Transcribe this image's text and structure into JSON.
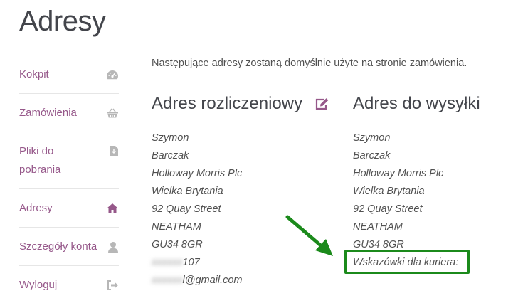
{
  "page": {
    "title": "Adresy"
  },
  "sidebar": {
    "items": [
      {
        "label": "Kokpit",
        "icon": "dashboard-icon"
      },
      {
        "label": "Zamówienia",
        "icon": "basket-icon"
      },
      {
        "label": "Pliki do pobrania",
        "icon": "file-download-icon"
      },
      {
        "label": "Adresy",
        "icon": "home-icon",
        "active": true
      },
      {
        "label": "Szczegóły konta",
        "icon": "user-icon"
      },
      {
        "label": "Wyloguj",
        "icon": "sign-out-icon"
      }
    ]
  },
  "main": {
    "intro": "Następujące adresy zostaną domyślnie użyte na stronie zamówienia.",
    "billing": {
      "title": "Adres rozliczeniowy",
      "lines": [
        "Szymon",
        "Barczak",
        "Holloway Morris Plc",
        "Wielka Brytania",
        "92 Quay Street",
        "NEATHAM",
        "GU34 8GR"
      ],
      "phone_visible": "107",
      "email_visible": "l@gmail.com"
    },
    "shipping": {
      "title": "Adres do wysyłki",
      "lines": [
        "Szymon",
        "Barczak",
        "Holloway Morris Plc",
        "Wielka Brytania",
        "92 Quay Street",
        "NEATHAM",
        "GU34 8GR"
      ],
      "courier_note": "Wskazówki dla kuriera:"
    }
  },
  "colors": {
    "accent": "#96588a",
    "highlight": "#1b8a1b",
    "icon_muted": "#b7b7b7"
  }
}
